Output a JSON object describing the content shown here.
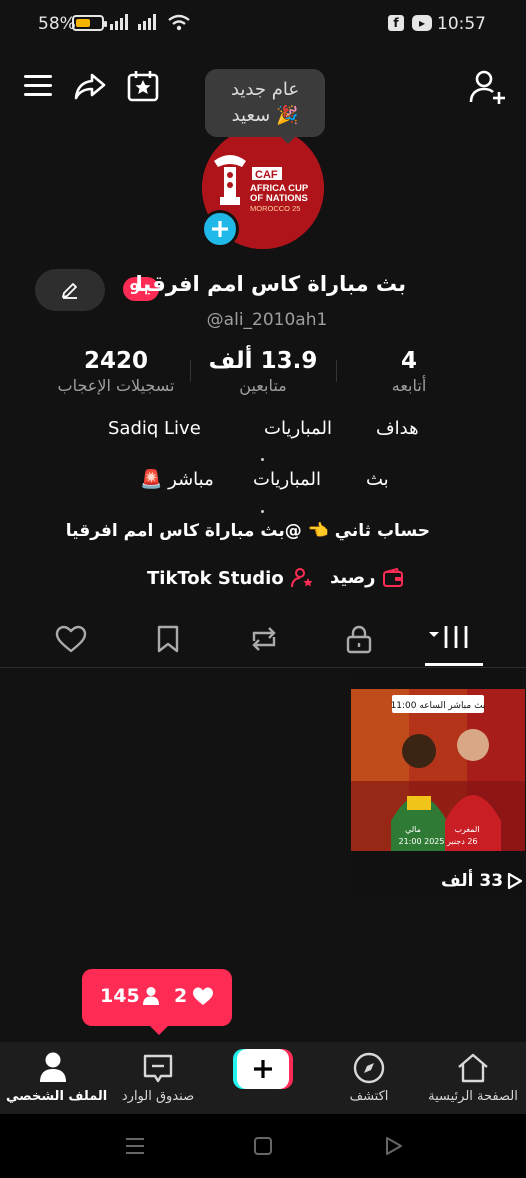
{
  "status_bar": {
    "battery": "58%",
    "battery_level": 0.58,
    "time": "10:57",
    "icons": [
      "signal-icon",
      "wifi-icon",
      "facebook-icon",
      "youtube-icon"
    ]
  },
  "header": {
    "icons": [
      "menu-icon",
      "share-icon",
      "calendar-star-icon",
      "add-user-icon"
    ]
  },
  "avatar": {
    "logo_line1": "CAF",
    "logo_line2": "AFRICA CUP",
    "logo_line3": "OF NATIONS",
    "logo_line4": "MOROCCO 25"
  },
  "tooltip": {
    "line1": "عام جديد",
    "line2": "سعيد 🎉"
  },
  "profile": {
    "name": "بث مباراة كاس امم افرقيا",
    "badge": "9+",
    "username": "@ali_2010ah1"
  },
  "stats": [
    {
      "value": "4",
      "label": "أتابعه"
    },
    {
      "value": "13.9 ألف",
      "label": "متابعين"
    },
    {
      "value": "2420",
      "label": "تسجيلات الإعجاب"
    }
  ],
  "bio": {
    "row1": [
      "هداف",
      "المباريات",
      "Sadiq Live"
    ],
    "row2": [
      "بث",
      "المباريات",
      "مباشر 🚨"
    ],
    "line3": "حساب ثاني 👈 @بث مباراة كاس امم افرقيا"
  },
  "links": {
    "balance": "رصيد",
    "studio": "TikTok Studio"
  },
  "content_tabs": [
    "grid-icon",
    "lock-icon",
    "repost-icon",
    "bookmark-icon",
    "heart-icon"
  ],
  "video": {
    "banner": "بث مباشر الساعه 11:00",
    "team1": "المغرب",
    "team2": "مالي",
    "match_info": "26 دجنبر 2025 21:00",
    "views": "33 ألف"
  },
  "notification": {
    "likes": "2",
    "followers": "145"
  },
  "bottom_nav": [
    {
      "label": "الصفحة الرئيسية",
      "icon": "home-icon"
    },
    {
      "label": "اكتشف",
      "icon": "compass-icon"
    },
    {
      "label": "",
      "icon": "plus-icon"
    },
    {
      "label": "صندوق الوارد",
      "icon": "inbox-icon"
    },
    {
      "label": "الملف الشخصي",
      "icon": "profile-icon"
    }
  ],
  "colors": {
    "accent": "#fe2c55",
    "cyan": "#20b8e6",
    "background": "#121212"
  }
}
